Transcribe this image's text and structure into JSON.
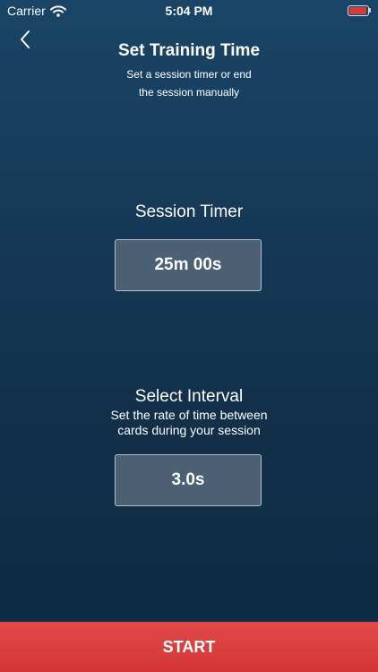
{
  "status_bar": {
    "carrier": "Carrier",
    "time": "5:04 PM",
    "battery_color": "#d63b3b"
  },
  "header": {
    "back_icon": "chevron-left-icon",
    "title": "Set Training Time",
    "subtitle_line1": "Set a session timer or end",
    "subtitle_line2": "the session manually"
  },
  "session_timer": {
    "title": "Session Timer",
    "value": "25m 00s"
  },
  "interval": {
    "title": "Select Interval",
    "description_line1": "Set the rate of time between",
    "description_line2": "cards during your session",
    "value": "3.0s"
  },
  "footer": {
    "start_label": "START",
    "button_color": "#d63b3b"
  },
  "colors": {
    "background_top": "#1a4566",
    "background_bottom": "#0f2a42",
    "box_fill": "#4b6074",
    "box_border": "#b5c0ca"
  }
}
